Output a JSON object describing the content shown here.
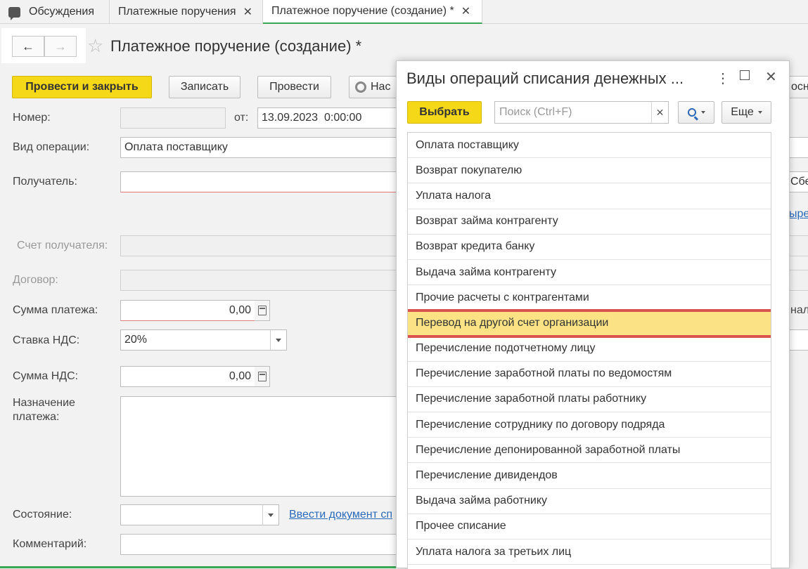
{
  "tabs": [
    {
      "label": "Обсуждения"
    },
    {
      "label": "Платежные поручения"
    },
    {
      "label": "Платежное поручение (создание) *"
    }
  ],
  "form": {
    "title": "Платежное поручение (создание) *",
    "buttons": {
      "post_close": "Провести и закрыть",
      "save": "Записать",
      "post": "Провести",
      "settings": "Нас"
    },
    "fields": {
      "number_label": "Номер:",
      "number_value": "",
      "date_label": "от:",
      "date_value": "13.09.2023  0:00:00",
      "operation_label": "Вид операции:",
      "operation_value": "Оплата поставщику",
      "recipient_label": "Получатель:",
      "recipient_account_label": "Счет получателя:",
      "contract_label": "Договор:",
      "amount_label": "Сумма платежа:",
      "amount_value": "0,00",
      "vat_rate_label": "Ставка НДС:",
      "vat_rate_value": "20%",
      "vat_amount_label": "Сумма НДС:",
      "vat_amount_value": "0,00",
      "purpose_label": "Назначение платежа:",
      "state_label": "Состояние:",
      "enter_doc_link": "Ввести документ сп",
      "comment_label": "Комментарий:"
    },
    "right_edge": {
      "text1": "осно",
      "text2": "Сбе",
      "link": "ыре",
      "text3": "нал"
    }
  },
  "popup": {
    "title": "Виды операций списания денежных ...",
    "select_button": "Выбрать",
    "search_placeholder": "Поиск (Ctrl+F)",
    "more_button": "Еще",
    "items": [
      "Оплата поставщику",
      "Возврат покупателю",
      "Уплата налога",
      "Возврат займа контрагенту",
      "Возврат кредита банку",
      "Выдача займа контрагенту",
      "Прочие расчеты с контрагентами",
      "Перевод на другой счет организации",
      "Перечисление подотчетному лицу",
      "Перечисление заработной платы по ведомостям",
      "Перечисление заработной платы работнику",
      "Перечисление сотруднику по договору подряда",
      "Перечисление депонированной заработной платы",
      "Перечисление дивидендов",
      "Выдача займа работнику",
      "Прочее списание",
      "Уплата налога за третьих лиц"
    ],
    "selected_index": 7
  }
}
